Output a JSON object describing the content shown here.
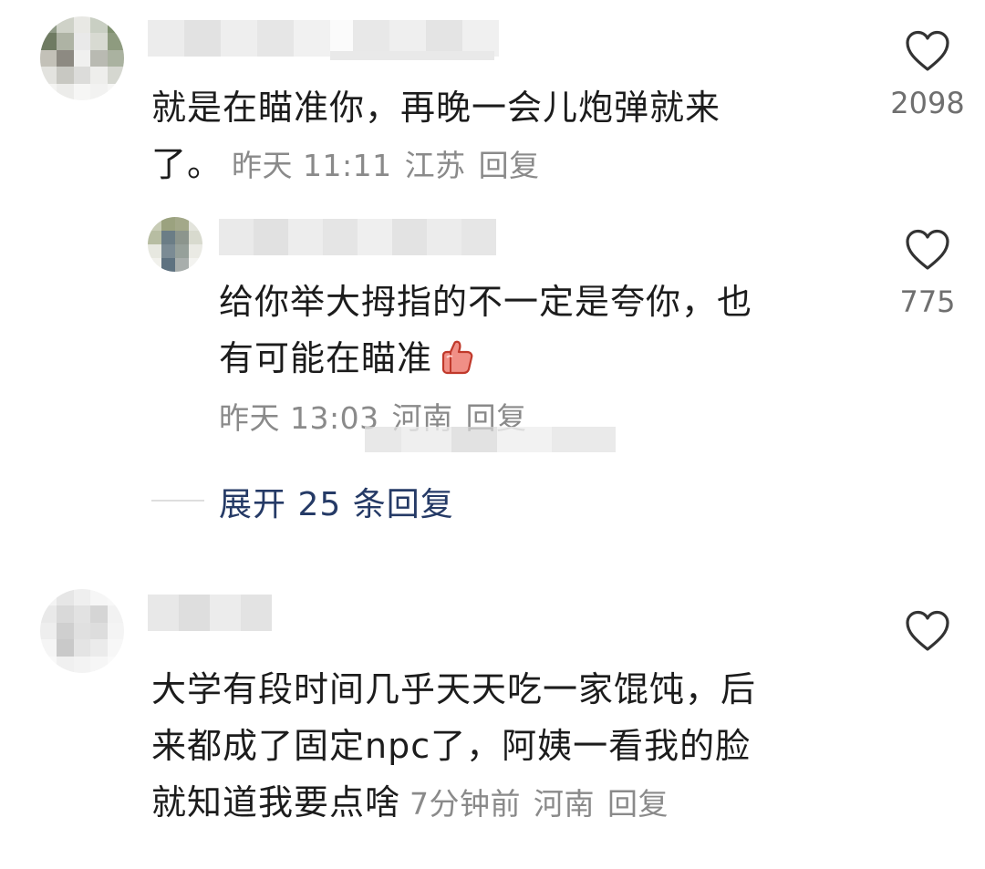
{
  "comments": [
    {
      "text_lines": [
        "就是在瞄准你，再晚一会儿炮弹就来",
        "了。"
      ],
      "time": "昨天 11:11",
      "location": "江苏",
      "reply_label": "回复",
      "like_count": "2098"
    },
    {
      "text_lines": [
        "给你举大拇指的不一定是夸你，也",
        "有可能在瞄准"
      ],
      "emoji": "thumbs-up",
      "time": "昨天 13:03",
      "location": "河南",
      "reply_label": "回复",
      "like_count": "775"
    },
    {
      "text_lines": [
        "大学有段时间几乎天天吃一家馄饨，后",
        "来都成了固定npc了，阿姨一看我的脸",
        "就知道我要点啥"
      ],
      "time": "7分钟前",
      "location": "河南",
      "reply_label": "回复",
      "like_count": ""
    }
  ],
  "expand_replies_label": "展开 25 条回复",
  "icons": {
    "like": "heart-outline-icon",
    "emoji": "thumbs-up-icon"
  },
  "colors": {
    "text": "#1c1c1c",
    "meta": "#8a8a8a",
    "link": "#253a66",
    "like_count": "#6f6f6f"
  }
}
